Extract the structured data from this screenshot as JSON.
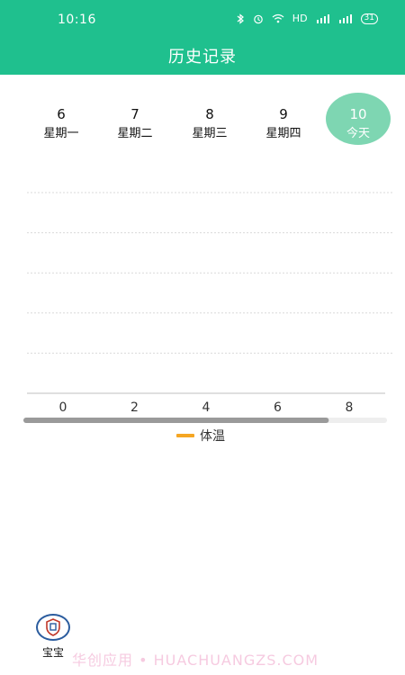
{
  "status_bar": {
    "time": "10:16",
    "network_label": "HD",
    "battery": "31"
  },
  "header": {
    "title": "历史记录",
    "background": "#1fc08e"
  },
  "days": [
    {
      "num": "6",
      "label": "星期一",
      "selected": false
    },
    {
      "num": "7",
      "label": "星期二",
      "selected": false
    },
    {
      "num": "8",
      "label": "星期三",
      "selected": false
    },
    {
      "num": "9",
      "label": "星期四",
      "selected": false
    },
    {
      "num": "10",
      "label": "今天",
      "selected": true
    }
  ],
  "chart_data": {
    "type": "line",
    "x_ticks": [
      "0",
      "2",
      "4",
      "6",
      "8"
    ],
    "series": [
      {
        "name": "体温",
        "values": [],
        "color": "#f5a623"
      }
    ],
    "grid": true,
    "legend": "bottom-center",
    "scrollbar_position": 0.84
  },
  "bottom_nav": {
    "items": [
      {
        "label": "宝宝",
        "icon": "shield-logo-icon"
      }
    ]
  },
  "watermark": "华创应用 • HUACHUANGZS.COM"
}
